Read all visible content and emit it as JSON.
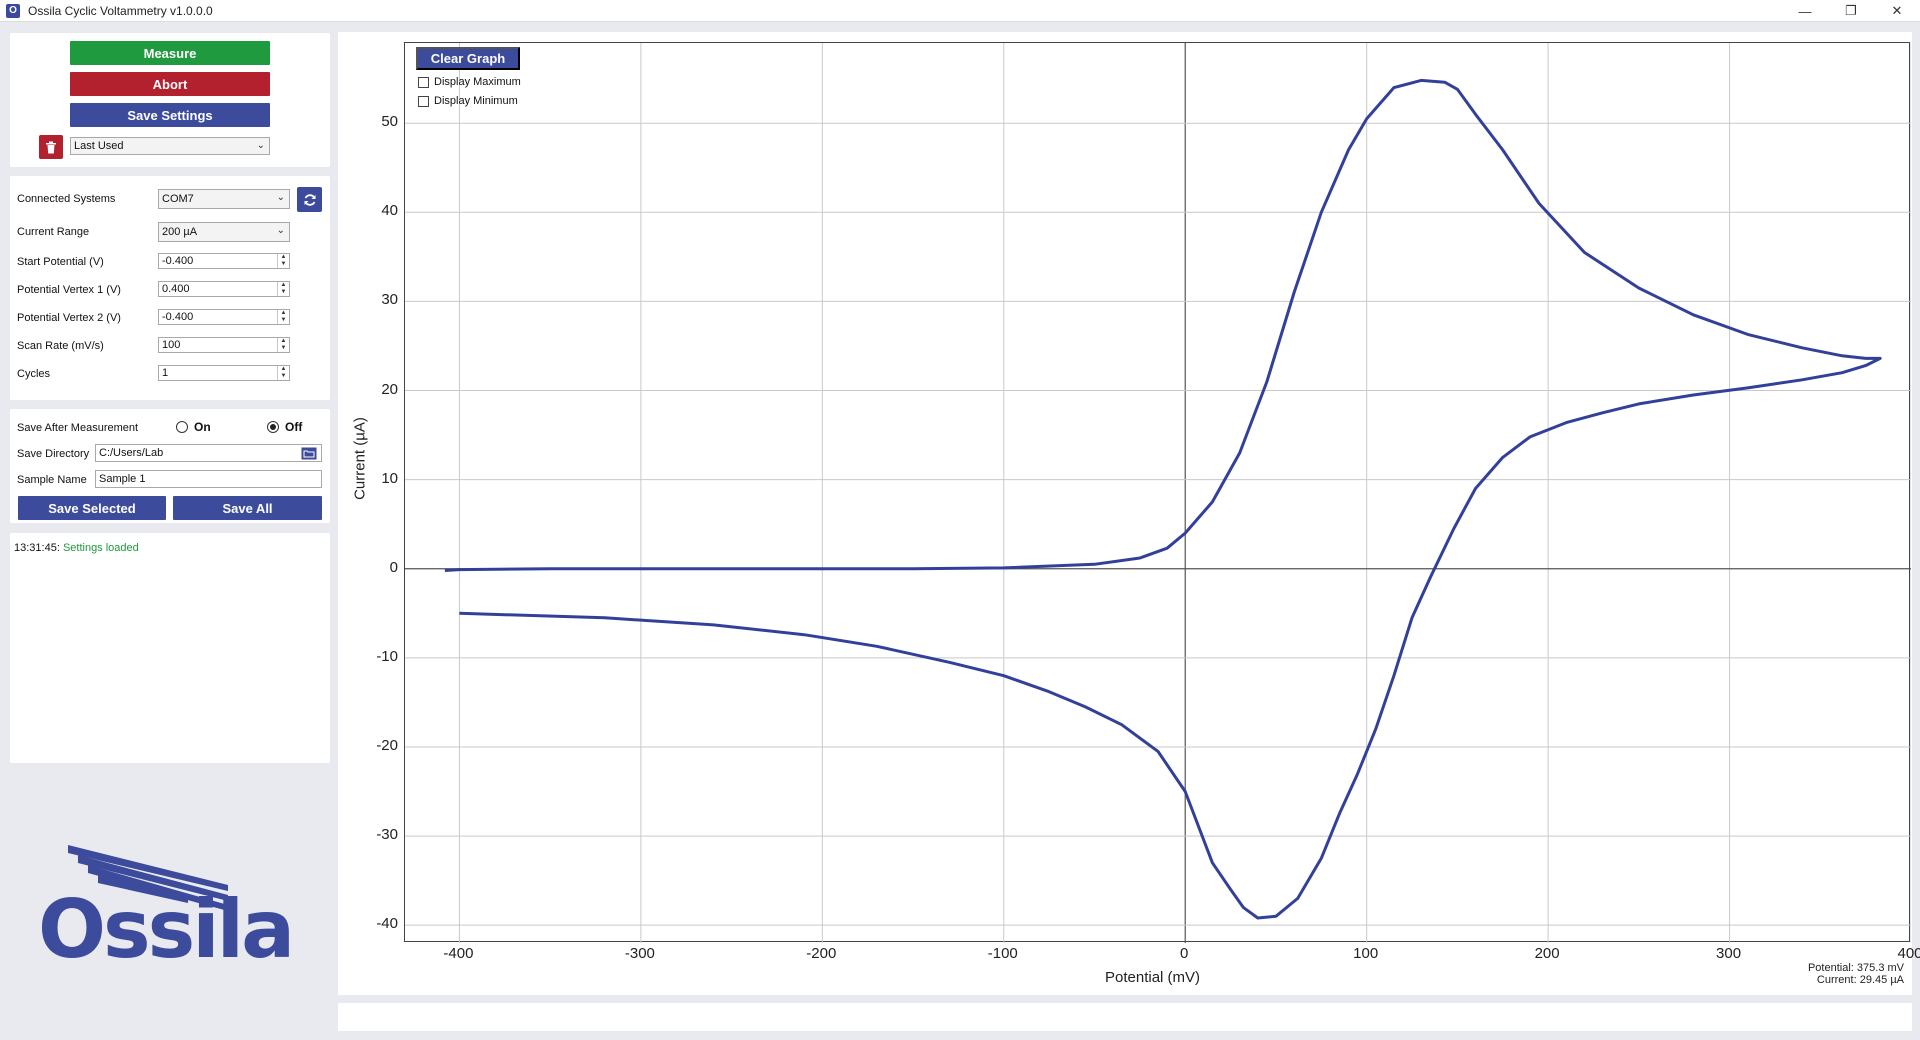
{
  "window": {
    "title": "Ossila Cyclic Voltammetry v1.0.0.0",
    "app_icon": "O",
    "minimize": "—",
    "maximize": "❐",
    "close": "✕"
  },
  "actions": {
    "measure": "Measure",
    "abort": "Abort",
    "save_settings": "Save Settings",
    "preset": "Last Used"
  },
  "settings": {
    "connected_systems": {
      "label": "Connected Systems",
      "value": "COM7"
    },
    "current_range": {
      "label": "Current Range",
      "value": "200 µA"
    },
    "start_potential": {
      "label": "Start Potential (V)",
      "value": "-0.400"
    },
    "vertex1": {
      "label": "Potential Vertex 1 (V)",
      "value": "0.400"
    },
    "vertex2": {
      "label": "Potential Vertex 2 (V)",
      "value": "-0.400"
    },
    "scan_rate": {
      "label": "Scan Rate (mV/s)",
      "value": "100"
    },
    "cycles": {
      "label": "Cycles",
      "value": "1"
    }
  },
  "save": {
    "after_label": "Save After Measurement",
    "on_label": "On",
    "off_label": "Off",
    "selected": "off",
    "dir_label": "Save Directory",
    "dir_value": "C:/Users/Lab",
    "sample_label": "Sample Name",
    "sample_value": "Sample 1",
    "save_selected": "Save Selected",
    "save_all": "Save All"
  },
  "log": {
    "time": "13:31:45:",
    "message": "Settings loaded"
  },
  "logo": {
    "text": "Ossila"
  },
  "graph": {
    "clear_button": "Clear Graph",
    "display_max": "Display Maximum",
    "display_min": "Display Minimum",
    "readout_potential_label": "Potential:",
    "readout_potential_value": "375.3",
    "readout_potential_unit": "mV",
    "readout_current_label": "Current:",
    "readout_current_value": "29.45",
    "readout_current_unit": "µA"
  },
  "colors": {
    "accent_blue": "#3c4b9b",
    "measure_green": "#1f9a3e",
    "abort_red": "#b3202e",
    "trace": "#33409a",
    "log_green": "#1f9a3e"
  },
  "chart_data": {
    "type": "line",
    "xlabel": "Potential (mV)",
    "ylabel": "Current (µA)",
    "xlim": [
      -430,
      400
    ],
    "ylim": [
      -42,
      59
    ],
    "xticks": [
      -400,
      -300,
      -200,
      -100,
      0,
      100,
      200,
      300,
      400
    ],
    "yticks": [
      -40,
      -30,
      -20,
      -10,
      0,
      10,
      20,
      30,
      40,
      50
    ],
    "grid": true,
    "series": [
      {
        "x": [
          -408,
          -400,
          -350,
          -300,
          -250,
          -200,
          -150,
          -100,
          -50,
          -25,
          -10,
          0,
          15,
          30,
          45,
          60,
          75,
          90,
          100,
          115,
          130,
          143,
          150,
          160,
          175,
          195,
          220,
          250,
          280,
          310,
          340,
          362,
          375,
          383,
          375,
          362,
          340,
          310,
          280,
          250,
          230,
          210,
          190,
          175,
          160,
          148,
          135,
          125,
          115,
          105,
          95,
          85,
          75,
          62,
          50,
          40,
          32,
          25,
          15,
          0,
          -15,
          -35,
          -55,
          -75,
          -100,
          -130,
          -170,
          -210,
          -260,
          -320,
          -400
        ],
        "y": [
          -0.2,
          -0.1,
          0,
          0,
          0,
          0,
          0,
          0.1,
          0.5,
          1.2,
          2.3,
          4,
          7.5,
          13,
          21,
          31,
          40,
          47,
          50.5,
          54,
          54.8,
          54.6,
          53.8,
          51,
          47,
          41,
          35.5,
          31.5,
          28.5,
          26.3,
          24.8,
          23.9,
          23.6,
          23.6,
          22.8,
          22,
          21.2,
          20.3,
          19.5,
          18.5,
          17.5,
          16.4,
          14.8,
          12.5,
          9,
          4.5,
          -1,
          -5.5,
          -12,
          -18,
          -23,
          -27.5,
          -32.5,
          -37,
          -39,
          -39.2,
          -38,
          -36,
          -33,
          -25,
          -20.5,
          -17.5,
          -15.5,
          -13.8,
          -12,
          -10.5,
          -8.7,
          -7.4,
          -6.3,
          -5.5,
          -5
        ]
      }
    ]
  }
}
